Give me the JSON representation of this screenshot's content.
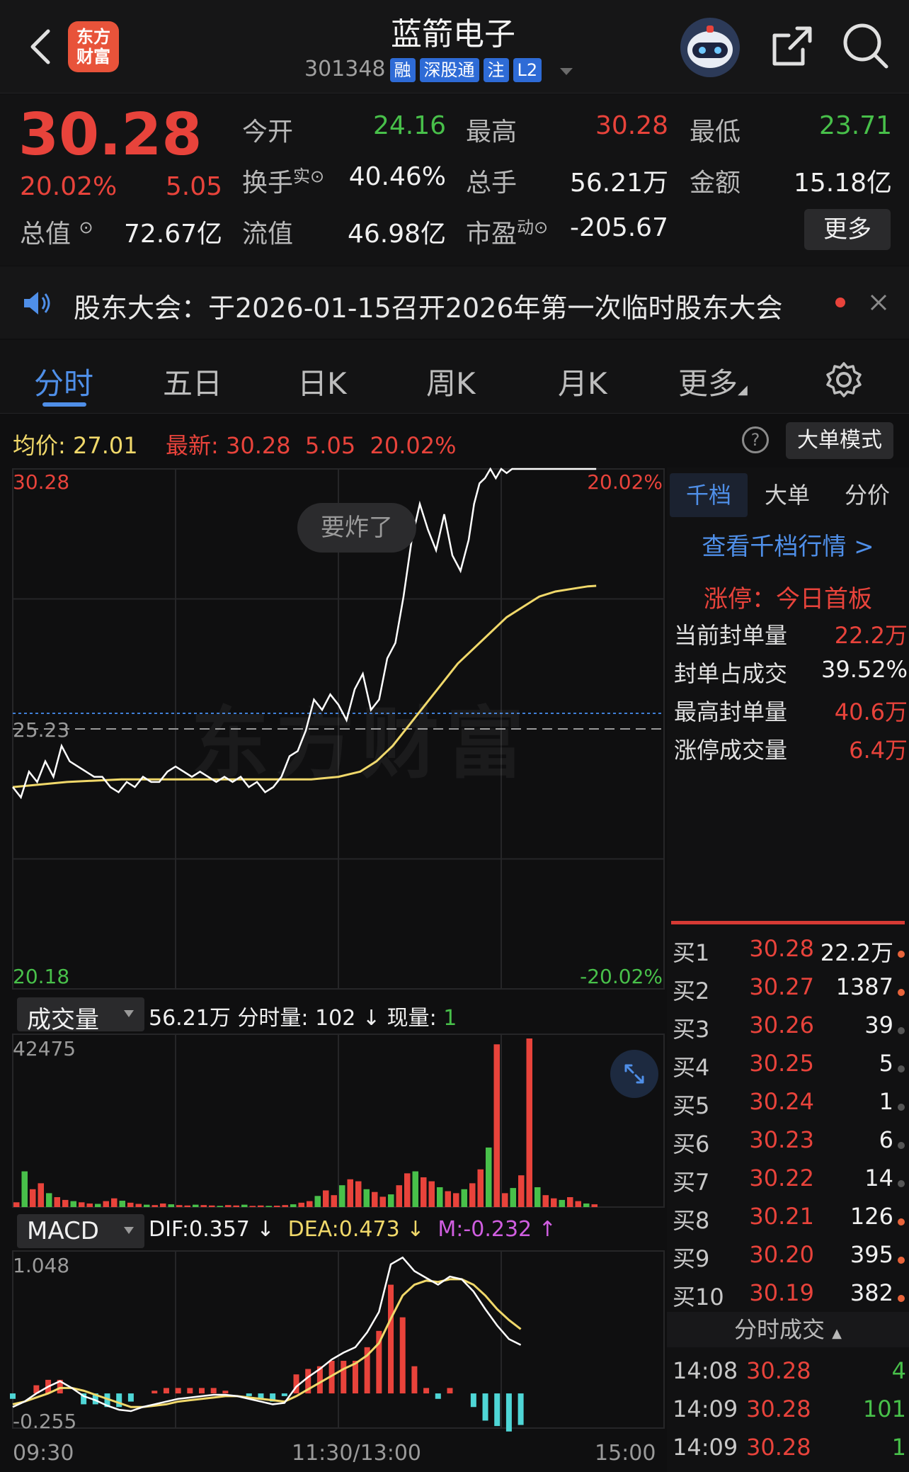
{
  "header": {
    "logo_line1": "东方",
    "logo_line2": "财富",
    "stock_name": "蓝箭电子",
    "stock_code": "301348",
    "tags": [
      "融",
      "深股通",
      "注",
      "L2"
    ]
  },
  "quote": {
    "price": "30.28",
    "change_pct": "20.02%",
    "change": "5.05",
    "open_label": "今开",
    "open": "24.16",
    "high_label": "最高",
    "high": "30.28",
    "low_label": "最低",
    "low": "23.71",
    "turnover_label": "换手",
    "turnover_sup": "实",
    "turnover": "40.46%",
    "volume_label": "总手",
    "volume": "56.21万",
    "amount_label": "金额",
    "amount": "15.18亿",
    "mktcap_label": "总值",
    "mktcap": "72.67亿",
    "float_label": "流值",
    "float": "46.98亿",
    "pe_label": "市盈",
    "pe_sup": "动",
    "pe": "-205.67",
    "more_button": "更多"
  },
  "notice": {
    "text": "股东大会：于2026-01-15召开2026年第一次临时股东大会"
  },
  "tabs": [
    "分时",
    "五日",
    "日K",
    "周K",
    "月K",
    "更多"
  ],
  "active_tab": 0,
  "chart_bar": {
    "avg_label": "均价:",
    "avg_value": "27.01",
    "latest_label": "最新:",
    "latest_price": "30.28",
    "latest_change": "5.05",
    "latest_pct": "20.02%",
    "mode_button": "大单模式"
  },
  "volume_bar": {
    "selector": "成交量",
    "total": "56.21万",
    "period_label": "分时量:",
    "period_value": "102",
    "period_arrow": "↓",
    "now_label": "现量:",
    "now_value": "1"
  },
  "macd_bar": {
    "selector": "MACD",
    "dif": "DIF:0.357 ↓",
    "dea": "DEA:0.473 ↓",
    "m": "M:-0.232 ↑"
  },
  "bubble": "要炸了",
  "watermark": "东方财富",
  "chart_data": [
    {
      "type": "line",
      "name": "price",
      "ylim": [
        20.18,
        30.28
      ],
      "prev_close": 25.23,
      "top_left_label": "30.28",
      "bottom_left_label": "20.18",
      "top_right_label": "20.02%",
      "bottom_right_label": "-20.02%",
      "prev_close_label": "25.23",
      "x_labels": [
        "09:30",
        "11:30/13:00",
        "15:00"
      ],
      "x_minutes_total": 240,
      "series": [
        {
          "values_x": [
            0,
            3,
            6,
            9,
            12,
            15,
            18,
            21,
            24,
            27,
            30,
            33,
            36,
            39,
            42,
            45,
            48,
            51,
            54,
            57,
            60,
            63,
            66,
            69,
            72,
            75,
            78,
            81,
            84,
            87,
            90,
            93,
            96,
            99,
            102,
            105,
            108,
            111,
            114,
            117,
            120,
            123,
            126,
            129,
            132,
            135,
            138,
            141,
            144,
            147,
            150,
            153,
            156,
            159,
            162,
            165,
            168,
            170,
            172,
            174,
            176,
            178,
            180,
            182,
            184,
            186,
            188,
            190,
            192,
            194,
            196,
            198,
            200,
            203,
            206,
            209,
            212,
            215
          ],
          "values_y": [
            24.1,
            23.9,
            24.4,
            24.2,
            24.6,
            24.3,
            24.9,
            24.6,
            24.5,
            24.4,
            24.3,
            24.3,
            24.1,
            24.0,
            24.2,
            24.1,
            24.3,
            24.2,
            24.2,
            24.4,
            24.5,
            24.4,
            24.3,
            24.4,
            24.3,
            24.2,
            24.3,
            24.2,
            24.3,
            24.1,
            24.2,
            24.0,
            24.1,
            24.3,
            24.7,
            24.8,
            25.2,
            25.8,
            25.6,
            25.9,
            25.7,
            25.4,
            26.0,
            26.3,
            25.6,
            25.8,
            26.6,
            26.9,
            27.8,
            28.9,
            29.6,
            29.1,
            28.7,
            29.4,
            28.6,
            28.3,
            28.9,
            29.6,
            30.0,
            30.1,
            30.28,
            30.1,
            30.28,
            30.2,
            30.28,
            30.28,
            30.28,
            30.28,
            30.28,
            30.28,
            30.28,
            30.28,
            30.28,
            30.28,
            30.28,
            30.28,
            30.28,
            30.28
          ]
        },
        {
          "values_x": [
            0,
            20,
            40,
            60,
            80,
            100,
            110,
            120,
            128,
            134,
            140,
            146,
            152,
            158,
            164,
            170,
            176,
            182,
            188,
            194,
            200,
            206,
            212,
            215
          ],
          "values_y": [
            24.1,
            24.2,
            24.25,
            24.25,
            24.25,
            24.25,
            24.25,
            24.3,
            24.4,
            24.6,
            24.9,
            25.3,
            25.7,
            26.1,
            26.5,
            26.8,
            27.1,
            27.4,
            27.6,
            27.8,
            27.9,
            27.95,
            28.0,
            28.01
          ]
        }
      ]
    },
    {
      "type": "bar",
      "name": "volume",
      "ylim": [
        0,
        42475
      ],
      "top_label": "42475",
      "values": [
        1200,
        9000,
        4500,
        6000,
        3500,
        2500,
        1800,
        1500,
        1200,
        900,
        800,
        1500,
        2200,
        1600,
        1100,
        800,
        600,
        500,
        900,
        700,
        500,
        400,
        600,
        500,
        400,
        300,
        500,
        400,
        600,
        300,
        400,
        300,
        350,
        500,
        700,
        1100,
        1500,
        2800,
        4200,
        3000,
        5500,
        7000,
        6500,
        4500,
        3800,
        2600,
        3200,
        5500,
        8500,
        9000,
        7500,
        6500,
        5000,
        4000,
        3500,
        4500,
        6000,
        9500,
        15000,
        41000,
        3500,
        4800,
        8000,
        42475,
        5000,
        3000,
        2200,
        1800,
        2500,
        1500,
        900,
        700
      ]
    },
    {
      "type": "line",
      "name": "macd",
      "ylim": [
        -0.255,
        1.048
      ],
      "top_label": "1.048",
      "bottom_label": "-0.255",
      "dif": [
        -0.1,
        -0.06,
        0.0,
        0.05,
        0.09,
        0.04,
        -0.02,
        -0.05,
        -0.09,
        -0.12,
        -0.13,
        -0.1,
        -0.08,
        -0.06,
        -0.04,
        -0.03,
        -0.02,
        -0.01,
        -0.01,
        -0.02,
        -0.04,
        -0.06,
        -0.08,
        -0.07,
        0.05,
        0.12,
        0.18,
        0.25,
        0.3,
        0.34,
        0.45,
        0.6,
        0.95,
        1.0,
        0.9,
        0.85,
        0.8,
        0.86,
        0.84,
        0.75,
        0.62,
        0.5,
        0.4,
        0.357
      ],
      "dea": [
        -0.08,
        -0.06,
        -0.03,
        0.0,
        0.04,
        0.04,
        0.02,
        -0.01,
        -0.04,
        -0.07,
        -0.1,
        -0.1,
        -0.09,
        -0.08,
        -0.06,
        -0.05,
        -0.04,
        -0.03,
        -0.02,
        -0.02,
        -0.03,
        -0.04,
        -0.05,
        -0.06,
        -0.02,
        0.03,
        0.08,
        0.13,
        0.18,
        0.22,
        0.28,
        0.37,
        0.55,
        0.72,
        0.8,
        0.83,
        0.82,
        0.84,
        0.84,
        0.8,
        0.72,
        0.62,
        0.54,
        0.473
      ],
      "m": [
        -0.04,
        0.0,
        0.06,
        0.1,
        0.1,
        0.0,
        -0.08,
        -0.08,
        -0.1,
        -0.1,
        -0.06,
        0.0,
        0.02,
        0.04,
        0.04,
        0.04,
        0.04,
        0.04,
        0.02,
        0.0,
        -0.02,
        -0.04,
        -0.06,
        -0.02,
        0.14,
        0.18,
        0.2,
        0.24,
        0.24,
        0.24,
        0.34,
        0.46,
        0.8,
        0.56,
        0.2,
        0.04,
        -0.04,
        0.04,
        0.0,
        -0.1,
        -0.2,
        -0.24,
        -0.28,
        -0.232
      ]
    }
  ],
  "rpanel": {
    "tabs": [
      "千档",
      "大单",
      "分价"
    ],
    "view_link": "查看千档行情 >",
    "limit_title": "涨停：今日首板",
    "stats": [
      {
        "label": "当前封单量",
        "value": "22.2万"
      },
      {
        "label": "封单占成交",
        "value": "39.52%"
      },
      {
        "label": "最高封单量",
        "value": "40.6万"
      },
      {
        "label": "涨停成交量",
        "value": "6.4万"
      }
    ],
    "orderbook": [
      {
        "label": "买1",
        "price": "30.28",
        "vol": "22.2万",
        "dot": "#e8643b"
      },
      {
        "label": "买2",
        "price": "30.27",
        "vol": "1387",
        "dot": "#e8643b"
      },
      {
        "label": "买3",
        "price": "30.26",
        "vol": "39",
        "dot": "#555555"
      },
      {
        "label": "买4",
        "price": "30.25",
        "vol": "5",
        "dot": "#555555"
      },
      {
        "label": "买5",
        "price": "30.24",
        "vol": "1",
        "dot": "#555555"
      },
      {
        "label": "买6",
        "price": "30.23",
        "vol": "6",
        "dot": "#555555"
      },
      {
        "label": "买7",
        "price": "30.22",
        "vol": "14",
        "dot": "#555555"
      },
      {
        "label": "买8",
        "price": "30.21",
        "vol": "126",
        "dot": "#e8643b"
      },
      {
        "label": "买9",
        "price": "30.20",
        "vol": "395",
        "dot": "#e8643b"
      },
      {
        "label": "买10",
        "price": "30.19",
        "vol": "382",
        "dot": "#e8643b"
      }
    ],
    "ticks_title": "分时成交",
    "ticks": [
      {
        "time": "14:08",
        "price": "30.28",
        "vol": "4"
      },
      {
        "time": "14:09",
        "price": "30.28",
        "vol": "101"
      },
      {
        "time": "14:09",
        "price": "30.28",
        "vol": "1"
      }
    ]
  },
  "colors": {
    "up": "#e8433b",
    "down": "#48c04a",
    "avg": "#f0d86a",
    "accent": "#4f8fe8"
  }
}
